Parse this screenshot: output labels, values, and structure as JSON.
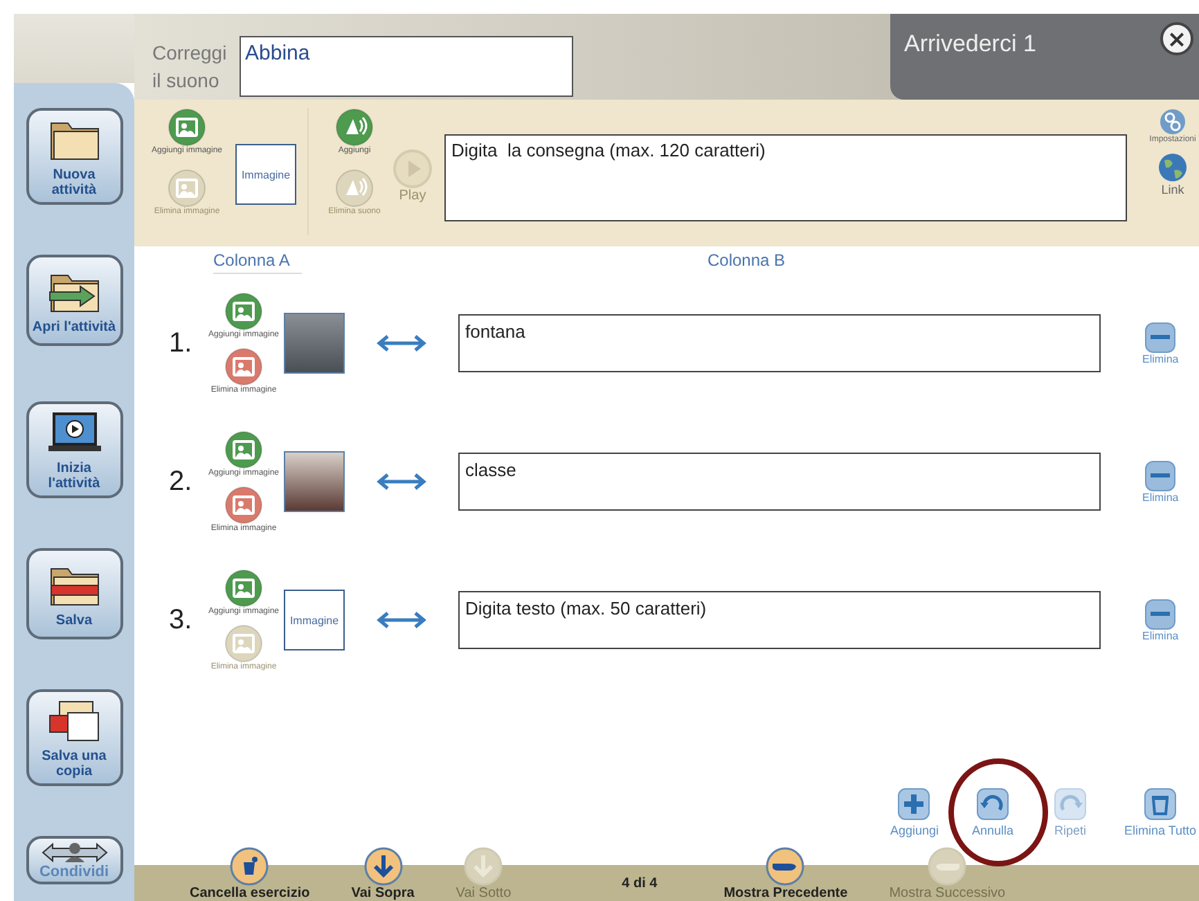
{
  "header": {
    "label": "Correggi il suono",
    "title_field": {
      "value": "Abbina"
    },
    "tab_title": "Arrivederci 1",
    "close": "×"
  },
  "sidebar": {
    "items": [
      {
        "label": "Nuova attività",
        "kind": "new"
      },
      {
        "label": "Apri l'attività",
        "kind": "open"
      },
      {
        "label": "Inizia l'attività",
        "kind": "start"
      },
      {
        "label": "Salva",
        "kind": "save"
      },
      {
        "label": "Salva una copia",
        "kind": "save_copy"
      },
      {
        "label": "Condividi",
        "kind": "share"
      }
    ]
  },
  "toolbar": {
    "image_buttons": [
      {
        "label": "Aggiungi immagine",
        "kind": "add",
        "disabled": false
      },
      {
        "label": "Elimina immagine",
        "kind": "remove",
        "disabled": true
      }
    ],
    "image_box": "Immagine",
    "sound_buttons": [
      {
        "label": "Aggiungi",
        "kind": "add",
        "disabled": false
      },
      {
        "label": "Elimina suono",
        "kind": "remove",
        "disabled": true
      }
    ],
    "play": {
      "label": "Play",
      "disabled": true
    },
    "instruction_field": {
      "placeholder": "Digita  la consegna (max. 120 caratteri)"
    },
    "side_buttons": [
      {
        "label": "Impostazioni",
        "kind": "settings"
      },
      {
        "label": "Link",
        "kind": "link"
      }
    ]
  },
  "columns": [
    "Colonna A",
    "Colonna B"
  ],
  "rows": [
    {
      "number": "1.",
      "add_image": {
        "label": "Aggiungi immagine",
        "disabled": false
      },
      "remove_image": {
        "label": "Elimina immagine",
        "disabled": false
      },
      "image": {
        "kind": "photo"
      },
      "text_field": {
        "value": "fontana"
      },
      "delete_label": "Elimina"
    },
    {
      "number": "2.",
      "add_image": {
        "label": "Aggiungi immagine",
        "disabled": false
      },
      "remove_image": {
        "label": "Elimina immagine",
        "disabled": false
      },
      "image": {
        "kind": "photo"
      },
      "text_field": {
        "value": "classe"
      },
      "delete_label": "Elimina"
    },
    {
      "number": "3.",
      "add_image": {
        "label": "Aggiungi immagine",
        "disabled": false
      },
      "remove_image": {
        "label": "Elimina immagine",
        "disabled": true
      },
      "image": {
        "kind": "empty",
        "label": "Immagine"
      },
      "text_field": {
        "placeholder": "Digita testo (max. 50 caratteri)"
      },
      "delete_label": "Elimina"
    }
  ],
  "actions": [
    {
      "label": "Aggiungi",
      "kind": "add",
      "disabled": false,
      "highlighted": false
    },
    {
      "label": "Annulla",
      "kind": "undo",
      "disabled": false,
      "highlighted": true
    },
    {
      "label": "Ripeti",
      "kind": "redo",
      "disabled": true,
      "highlighted": false
    },
    {
      "label": "Elimina Tutto",
      "kind": "delete_all",
      "disabled": false,
      "highlighted": false
    }
  ],
  "bottom_bar": {
    "items": [
      {
        "label": "Cancella esercizio",
        "kind": "trash",
        "disabled": false
      },
      {
        "label": "Vai Sopra",
        "kind": "up",
        "disabled": false
      },
      {
        "label": "Vai Sotto",
        "kind": "down",
        "disabled": true
      },
      {
        "label": "4 di 4",
        "kind": "counter"
      },
      {
        "label": "Mostra Precedente",
        "kind": "prev",
        "disabled": false
      },
      {
        "label": "Mostra Successivo",
        "kind": "next",
        "disabled": true
      }
    ]
  }
}
